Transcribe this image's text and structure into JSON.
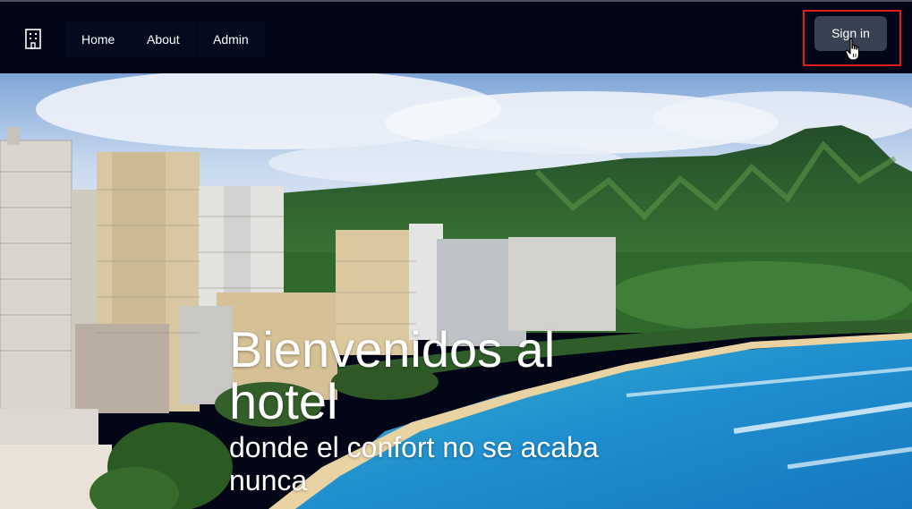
{
  "navbar": {
    "logo_icon": "building-icon",
    "links": [
      {
        "label": "Home"
      },
      {
        "label": "About"
      },
      {
        "label": "Admin"
      }
    ],
    "signin_label": "Sign in"
  },
  "hero": {
    "title": "Bienvenidos al hotel",
    "subtitle": "donde el confort no se acaba nunca"
  },
  "colors": {
    "navbar_bg": "#020617",
    "signin_bg": "#374151",
    "highlight": "#e11d1d"
  }
}
